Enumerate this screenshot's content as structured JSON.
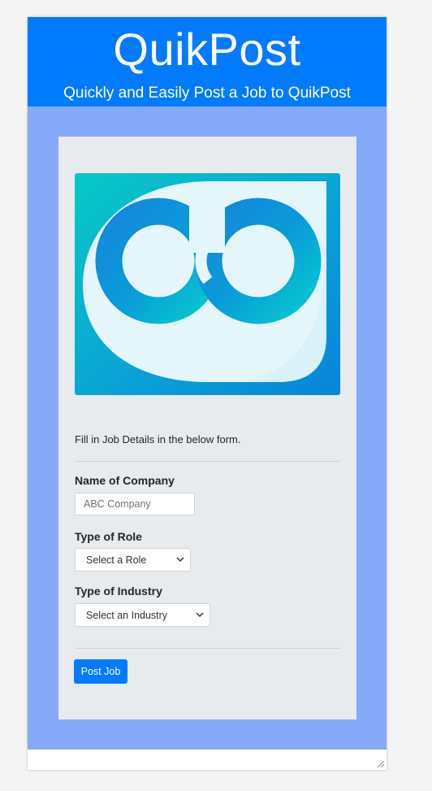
{
  "header": {
    "title": "QuikPost",
    "subtitle": "Quickly and Easily Post a Job to QuikPost"
  },
  "logo": {
    "icon": "co-logo",
    "text": "CO"
  },
  "form": {
    "intro": "Fill in Job Details in the below form.",
    "company_label": "Name of Company",
    "company_placeholder": "ABC Company",
    "company_value": "",
    "role_label": "Type of Role",
    "role_selected": "Select a Role",
    "industry_label": "Type of Industry",
    "industry_selected": "Select an Industry",
    "submit_label": "Post Job"
  },
  "colors": {
    "header_bg": "#007bff",
    "page_bg": "#85a8f7",
    "card_bg": "#e8ebee",
    "button_bg": "#007bff"
  }
}
